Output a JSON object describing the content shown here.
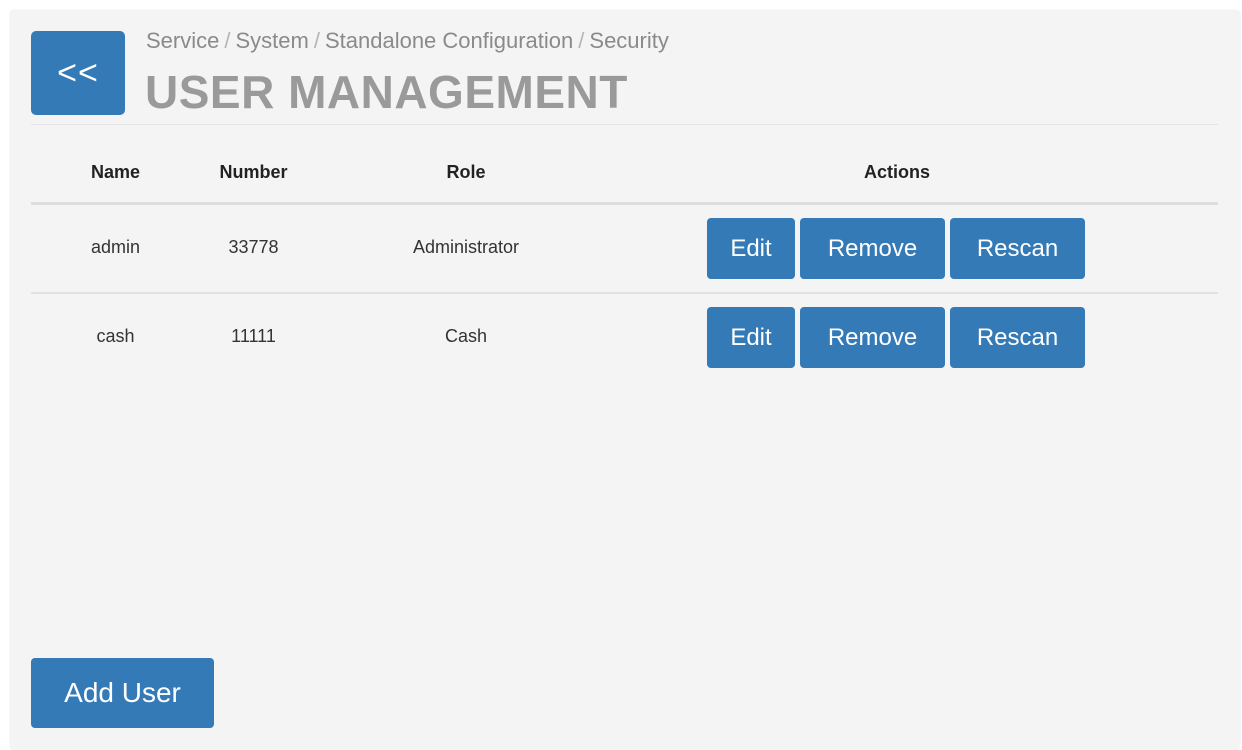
{
  "header": {
    "back_label": "<<",
    "breadcrumb": [
      "Service",
      "System",
      "Standalone Configuration",
      "Security"
    ],
    "title": "USER MANAGEMENT"
  },
  "table": {
    "columns": {
      "name": "Name",
      "number": "Number",
      "role": "Role",
      "actions": "Actions"
    },
    "rows": [
      {
        "name": "admin",
        "number": "33778",
        "role": "Administrator"
      },
      {
        "name": "cash",
        "number": "11111",
        "role": "Cash"
      }
    ],
    "actions": {
      "edit": "Edit",
      "remove": "Remove",
      "rescan": "Rescan"
    }
  },
  "footer": {
    "add_user_label": "Add User"
  },
  "colors": {
    "primary": "#337ab7",
    "panel_background": "#f4f4f4",
    "title": "#9a9a9a"
  }
}
